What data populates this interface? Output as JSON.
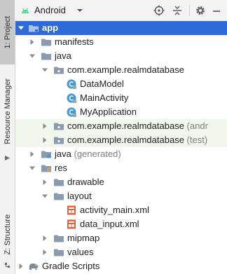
{
  "toolbar": {
    "view_label": "Android",
    "icons": [
      "android-icon",
      "dropdown-caret-icon",
      "locate-icon",
      "collapse-all-icon",
      "gear-icon",
      "minimize-icon"
    ]
  },
  "side_tabs": {
    "project": "1: Project",
    "resource_manager": "Resource Manager",
    "structure": "Z: Structure"
  },
  "tree": {
    "app": "app",
    "manifests": "manifests",
    "java": "java",
    "pkg_main": "com.example.realmdatabase",
    "data_model": "DataModel",
    "main_activity": "MainActivity",
    "my_application": "MyApplication",
    "pkg_android_test": "com.example.realmdatabase",
    "pkg_android_test_extra": "(andr",
    "pkg_test": "com.example.realmdatabase",
    "pkg_test_extra": "(test)",
    "java_generated": "java",
    "java_generated_extra": "(generated)",
    "res": "res",
    "drawable": "drawable",
    "layout": "layout",
    "activity_main": "activity_main.xml",
    "data_input": "data_input.xml",
    "mipmap": "mipmap",
    "values": "values",
    "gradle_scripts": "Gradle Scripts"
  },
  "colors": {
    "selection": "#2e6ad8",
    "folder": "#8a9bb0",
    "class_icon": "#3e9bd6",
    "xml_icon": "#e0643c",
    "android_green": "#3ddc84"
  }
}
